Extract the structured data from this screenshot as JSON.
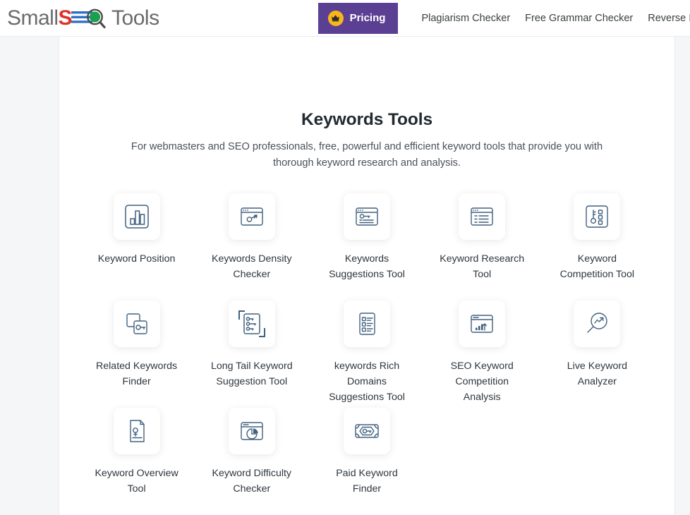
{
  "brand": {
    "name": "SmallSEOTools",
    "part1": "Small",
    "part_s": "S",
    "part_e": "E",
    "part_o": "O",
    "part2": "Tools",
    "colors": {
      "red": "#e03127",
      "blue": "#2f6fc4",
      "green": "#1aa04c",
      "gray": "#6b6b6b"
    }
  },
  "header": {
    "pricing_label": "Pricing",
    "crown_icon": "crown-icon",
    "pricing_bg": "#5b3f93",
    "crown_bg": "#f7b71c",
    "links": [
      {
        "label": "Plagiarism Checker"
      },
      {
        "label": "Free Grammar Checker"
      },
      {
        "label": "Reverse Image"
      }
    ]
  },
  "main": {
    "title": "Keywords Tools",
    "subtitle": "For webmasters and SEO professionals, free, powerful and efficient keyword tools that provide you with thorough keyword research and analysis.",
    "tools": [
      {
        "label": "Keyword Position",
        "icon": "bar-chart-icon"
      },
      {
        "label": "Keywords Density Checker",
        "icon": "browser-key-arrow-icon"
      },
      {
        "label": "Keywords Suggestions Tool",
        "icon": "browser-key-list-icon"
      },
      {
        "label": "Keyword Research Tool",
        "icon": "browser-list-icon"
      },
      {
        "label": "Keyword Competition Tool",
        "icon": "key-checkboxes-icon"
      },
      {
        "label": "Related Keywords Finder",
        "icon": "stacked-squares-key-icon"
      },
      {
        "label": "Long Tail Keyword Suggestion Tool",
        "icon": "document-keys-list-icon"
      },
      {
        "label": "keywords Rich Domains Suggestions Tool",
        "icon": "checklist-document-icon"
      },
      {
        "label": "SEO Keyword Competition Analysis",
        "icon": "browser-growth-chart-icon"
      },
      {
        "label": "Live Keyword Analyzer",
        "icon": "magnifier-trend-icon"
      },
      {
        "label": "Keyword Overview Tool",
        "icon": "document-key-icon"
      },
      {
        "label": "Keyword Difficulty Checker",
        "icon": "browser-pie-chart-icon"
      },
      {
        "label": "Paid Keyword Finder",
        "icon": "banknote-key-icon"
      }
    ]
  }
}
